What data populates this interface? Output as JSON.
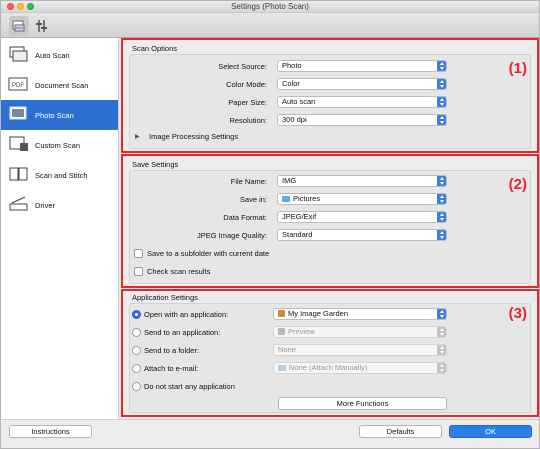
{
  "window": {
    "title": "Settings (Photo Scan)"
  },
  "toolbar": [
    {
      "icon": "scan-from-computer-icon",
      "active": true
    },
    {
      "icon": "general-settings-icon",
      "active": false
    }
  ],
  "sidebar": {
    "items": [
      {
        "label": "Auto Scan",
        "icon": "auto-scan-icon",
        "selected": false
      },
      {
        "label": "Document Scan",
        "icon": "document-scan-icon",
        "selected": false
      },
      {
        "label": "Photo Scan",
        "icon": "photo-scan-icon",
        "selected": true
      },
      {
        "label": "Custom Scan",
        "icon": "custom-scan-icon",
        "selected": false
      },
      {
        "label": "Scan and Stitch",
        "icon": "scan-and-stitch-icon",
        "selected": false
      },
      {
        "label": "Driver",
        "icon": "driver-icon",
        "selected": false
      }
    ]
  },
  "scan_options": {
    "title": "Scan Options",
    "badge": "(1)",
    "select_source_label": "Select Source:",
    "select_source_value": "Photo",
    "color_mode_label": "Color Mode:",
    "color_mode_value": "Color",
    "paper_size_label": "Paper Size:",
    "paper_size_value": "Auto scan",
    "resolution_label": "Resolution:",
    "resolution_value": "300 dpi",
    "image_processing_label": "Image Processing Settings"
  },
  "save_settings": {
    "title": "Save Settings",
    "badge": "(2)",
    "file_name_label": "File Name:",
    "file_name_value": "IMG",
    "save_in_label": "Save in:",
    "save_in_value": "Pictures",
    "data_format_label": "Data Format:",
    "data_format_value": "JPEG/Exif",
    "jpeg_quality_label": "JPEG Image Quality:",
    "jpeg_quality_value": "Standard",
    "subfolder_label": "Save to a subfolder with current date",
    "check_results_label": "Check scan results"
  },
  "application_settings": {
    "title": "Application Settings",
    "badge": "(3)",
    "open_app_label": "Open with an application:",
    "open_app_value": "My Image Garden",
    "send_app_label": "Send to an application:",
    "send_app_value": "Preview",
    "send_folder_label": "Send to a folder:",
    "send_folder_value": "None",
    "attach_email_label": "Attach to e-mail:",
    "attach_email_value": "None (Attach Manually)",
    "no_app_label": "Do not start any application",
    "more_functions_label": "More Functions"
  },
  "footer": {
    "instructions_label": "Instructions",
    "defaults_label": "Defaults",
    "ok_label": "OK"
  },
  "colors": {
    "highlight": "#e8262c",
    "accent": "#2e70d1",
    "primary_button": "#2e7ee9"
  }
}
